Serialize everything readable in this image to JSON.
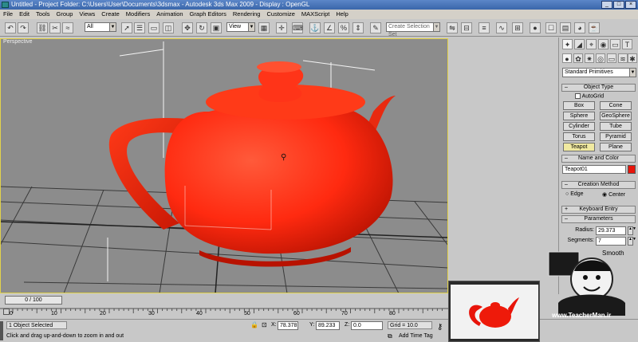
{
  "titlebar": {
    "text": "Untitled    - Project Folder: C:\\Users\\User\\Documents\\3dsmax    - Autodesk 3ds Max  2009     - Display : OpenGL"
  },
  "menu": [
    "File",
    "Edit",
    "Tools",
    "Group",
    "Views",
    "Create",
    "Modifiers",
    "Animation",
    "Graph Editors",
    "Rendering",
    "Customize",
    "MAXScript",
    "Help"
  ],
  "toolbar": {
    "filter_value": "All",
    "refcoord_value": "View",
    "selection_set_placeholder": "Create Selection Set"
  },
  "viewport": {
    "label": "Perspective",
    "object_color": "#ff2a10",
    "background": "#8c8c8c"
  },
  "cmdpanel": {
    "category_value": "Standard Primitives",
    "object_type": {
      "title": "Object Type",
      "autogrid": "AutoGrid",
      "buttons": [
        [
          "Box",
          "Cone"
        ],
        [
          "Sphere",
          "GeoSphere"
        ],
        [
          "Cylinder",
          "Tube"
        ],
        [
          "Torus",
          "Pyramid"
        ],
        [
          "Teapot",
          "Plane"
        ]
      ]
    },
    "name_color": {
      "title": "Name and Color",
      "name": "Teapot01",
      "swatch": "#e8140a"
    },
    "creation": {
      "title": "Creation Method",
      "edge": "Edge",
      "center": "Center"
    },
    "keyboard": {
      "title": "Keyboard Entry"
    },
    "params": {
      "title": "Parameters",
      "radius_label": "Radius:",
      "radius": "29.373",
      "segments_label": "Segments:",
      "segments": "7",
      "smooth": "Smooth"
    }
  },
  "timeline": {
    "frame": "0 / 100",
    "ticks": [
      "0",
      "10",
      "20",
      "30",
      "40",
      "50",
      "60",
      "70",
      "80"
    ]
  },
  "status": {
    "selected": "1 Object Selected",
    "prompt": "Click and drag up-and-down to zoom in and out",
    "x_label": "X:",
    "x": "78.378",
    "y_label": "Y:",
    "y": "89.233",
    "z_label": "Z:",
    "z": "0.0",
    "grid": "Grid = 10.0",
    "add_time_tag": "Add Time Tag"
  },
  "watermark": {
    "brand": "www.TeacherMan.ir"
  }
}
